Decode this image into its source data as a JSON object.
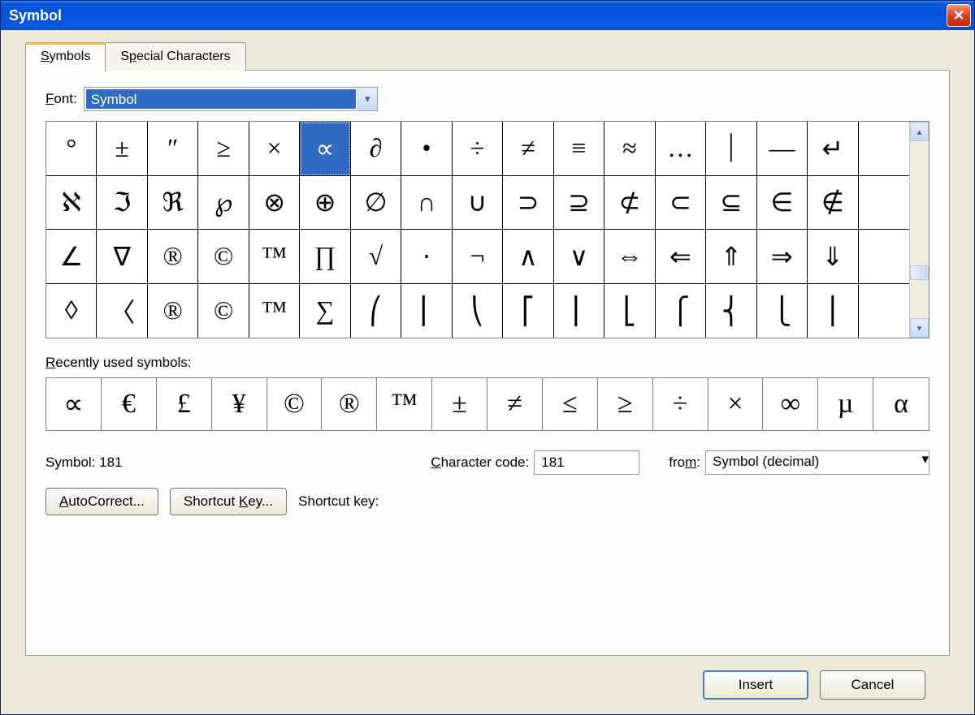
{
  "window": {
    "title": "Symbol"
  },
  "tabs": {
    "symbols": "Symbols",
    "special": "Special Characters"
  },
  "font": {
    "label": "Font:",
    "value": "Symbol"
  },
  "grid": {
    "selectedIndex": 5,
    "rows": [
      [
        "°",
        "±",
        "″",
        "≥",
        "×",
        "∝",
        "∂",
        "•",
        "÷",
        "≠",
        "≡",
        "≈",
        "…",
        "⏐",
        "—",
        "↵",
        ""
      ],
      [
        "ℵ",
        "ℑ",
        "ℜ",
        "℘",
        "⊗",
        "⊕",
        "∅",
        "∩",
        "∪",
        "⊃",
        "⊇",
        "⊄",
        "⊂",
        "⊆",
        "∈",
        "∉",
        ""
      ],
      [
        "∠",
        "∇",
        "®",
        "©",
        "™",
        "∏",
        "√",
        "⋅",
        "¬",
        "∧",
        "∨",
        "⇔",
        "⇐",
        "⇑",
        "⇒",
        "⇓",
        ""
      ],
      [
        "◊",
        "〈",
        "®",
        "©",
        "™",
        "∑",
        "⎛",
        "⎜",
        "⎝",
        "⎡",
        "⎢",
        "⎣",
        "⎧",
        "⎨",
        "⎩",
        "⎪",
        ""
      ]
    ]
  },
  "recent": {
    "label": "Recently used symbols:",
    "items": [
      "∝",
      "€",
      "£",
      "¥",
      "©",
      "®",
      "™",
      "±",
      "≠",
      "≤",
      "≥",
      "÷",
      "×",
      "∞",
      "µ",
      "α"
    ]
  },
  "info": {
    "symbolLabel": "Symbol: 181",
    "charCodeLabel": "Character code:",
    "charCodeValue": "181",
    "fromLabel": "from:",
    "fromValue": "Symbol (decimal)"
  },
  "buttons": {
    "autocorrect": "AutoCorrect...",
    "shortcutKey": "Shortcut Key...",
    "shortcutLabel": "Shortcut key:",
    "insert": "Insert",
    "cancel": "Cancel"
  }
}
